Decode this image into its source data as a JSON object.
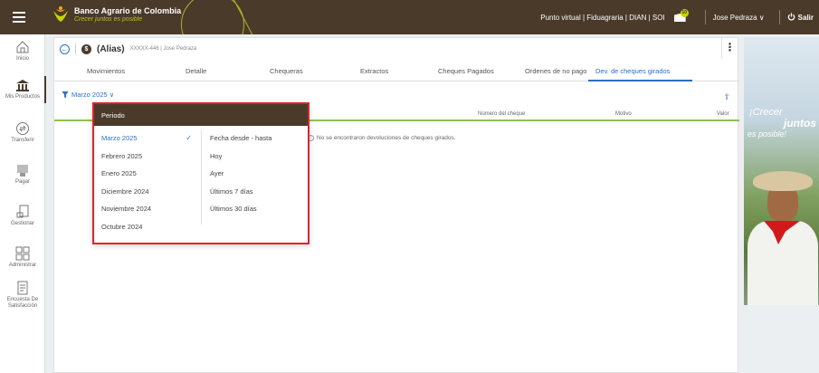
{
  "topbar": {
    "brand_name": "Banco Agrario de Colombia",
    "brand_tagline": "Crecer juntos es posible",
    "links": "Punto virtual | Fiduagraria | DIAN | SOI",
    "notification_count": "10",
    "user": "Jose Pedraza ∨",
    "logout": "Salir"
  },
  "sidebar": {
    "items": [
      {
        "label": "Inicio",
        "icon": "home-icon"
      },
      {
        "label": "Mis Productos",
        "icon": "bank-icon"
      },
      {
        "label": "Transferir",
        "icon": "transfer-icon"
      },
      {
        "label": "Pagar",
        "icon": "pay-icon"
      },
      {
        "label": "Gestionar",
        "icon": "manage-icon"
      },
      {
        "label": "Administrar",
        "icon": "admin-icon"
      },
      {
        "label": "Encuesta De Satisfacción",
        "icon": "survey-icon"
      }
    ]
  },
  "account": {
    "alias": "(Alias)",
    "meta": "XXXXX-446 | Jose Pedraza"
  },
  "tabs": [
    {
      "label": "Movimientos"
    },
    {
      "label": "Detalle"
    },
    {
      "label": "Chequeras"
    },
    {
      "label": "Extractos"
    },
    {
      "label": "Cheques Pagados"
    },
    {
      "label": "Ordenes de no pago"
    },
    {
      "label": "Dev. de cheques girados"
    }
  ],
  "filter": {
    "label": "Marzo 2025 ∨"
  },
  "table": {
    "columns": [
      "Número del cheque",
      "Motivo",
      "Valor"
    ],
    "empty_message": "No se encontraron devoluciones de cheques girados."
  },
  "dropdown": {
    "header": "Periodo",
    "months": [
      "Marzo 2025",
      "Febrero 2025",
      "Enero 2025",
      "Diciembre 2024",
      "Noviembre 2024",
      "Octubre 2024"
    ],
    "selected_month": "Marzo 2025",
    "ranges": [
      "Fecha desde - hasta",
      "Hoy",
      "Ayer",
      "Últimos 7 días",
      "Últimos 30 días"
    ]
  },
  "ad": {
    "line1": "¡Crecer",
    "line2": "juntos",
    "line3": "es posible!"
  },
  "colors": {
    "brand_brown": "#4a3a2a",
    "accent_blue": "#2a6fc8",
    "accent_green": "#8bc34a",
    "highlight_red": "#e0222a"
  }
}
